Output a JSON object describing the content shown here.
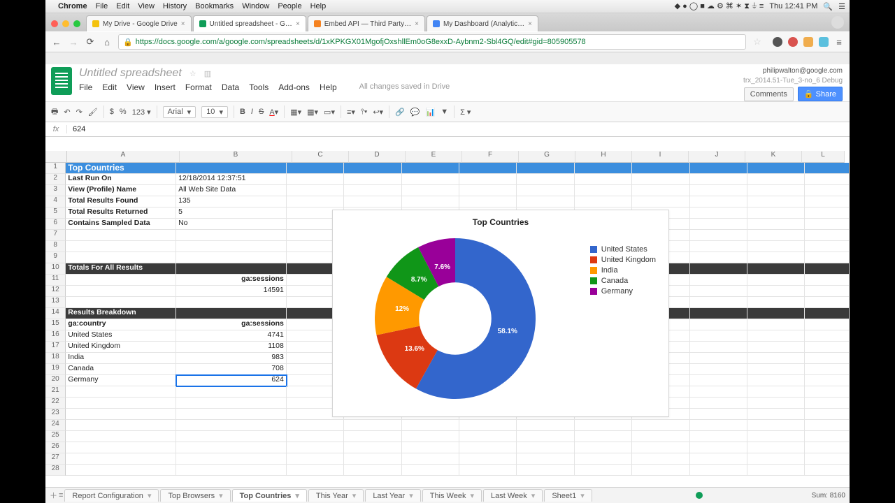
{
  "mac_menu": {
    "app": "Chrome",
    "items": [
      "File",
      "Edit",
      "View",
      "History",
      "Bookmarks",
      "Window",
      "People",
      "Help"
    ],
    "clock": "Thu 12:41 PM"
  },
  "browser": {
    "tabs": [
      {
        "title": "My Drive - Google Drive",
        "active": false
      },
      {
        "title": "Untitled spreadsheet - G…",
        "active": true
      },
      {
        "title": "Embed API — Third Party…",
        "active": false
      },
      {
        "title": "My Dashboard (Analytic…",
        "active": false
      }
    ],
    "url": "https://docs.google.com/a/google.com/spreadsheets/d/1xKPKGX01MgofjOxshllEm0oG8exxD-Aybnm2-Sbl4GQ/edit#gid=805905578"
  },
  "doc": {
    "title": "Untitled spreadsheet",
    "account": "philipwalton@google.com",
    "build": "trx_2014.51-Tue_3-no_6  Debug",
    "menus": [
      "File",
      "Edit",
      "View",
      "Insert",
      "Format",
      "Data",
      "Tools",
      "Add-ons",
      "Help"
    ],
    "saved": "All changes saved in Drive",
    "comments": "Comments",
    "share": "Share"
  },
  "toolbar": {
    "font": "Arial",
    "size": "10",
    "currency": "$",
    "pct": "%",
    "dec": "123"
  },
  "fx": {
    "value": "624"
  },
  "columns": [
    "A",
    "B",
    "C",
    "D",
    "E",
    "F",
    "G",
    "H",
    "I",
    "J",
    "K",
    "L"
  ],
  "sheet": {
    "header": "Top Countries",
    "meta": [
      {
        "k": "Last Run On",
        "v": "12/18/2014 12:37:51"
      },
      {
        "k": "View (Profile) Name",
        "v": "All Web Site Data"
      },
      {
        "k": "Total Results Found",
        "v": "135"
      },
      {
        "k": "Total Results Returned",
        "v": "5"
      },
      {
        "k": "Contains Sampled Data",
        "v": "No"
      }
    ],
    "totals_header": "Totals For All Results",
    "totals_metric": "ga:sessions",
    "totals_value": "14591",
    "breakdown_header": "Results Breakdown",
    "dim_header": "ga:country",
    "met_header": "ga:sessions",
    "rows": [
      {
        "country": "United States",
        "sessions": "4741"
      },
      {
        "country": "United Kingdom",
        "sessions": "1108"
      },
      {
        "country": "India",
        "sessions": "983"
      },
      {
        "country": "Canada",
        "sessions": "708"
      },
      {
        "country": "Germany",
        "sessions": "624"
      }
    ]
  },
  "chart_data": {
    "type": "pie",
    "title": "Top Countries",
    "series": [
      {
        "name": "United States",
        "value": 58.1,
        "color": "#3366cc"
      },
      {
        "name": "United Kingdom",
        "value": 13.6,
        "color": "#dc3912"
      },
      {
        "name": "India",
        "value": 12.0,
        "color": "#ff9900"
      },
      {
        "name": "Canada",
        "value": 8.7,
        "color": "#109618"
      },
      {
        "name": "Germany",
        "value": 7.6,
        "color": "#990099"
      }
    ]
  },
  "sheet_tabs": [
    "Report Configuration",
    "Top Browsers",
    "Top Countries",
    "This Year",
    "Last Year",
    "This Week",
    "Last Week",
    "Sheet1"
  ],
  "active_sheet": "Top Countries",
  "footer_sum": "Sum: 8160"
}
